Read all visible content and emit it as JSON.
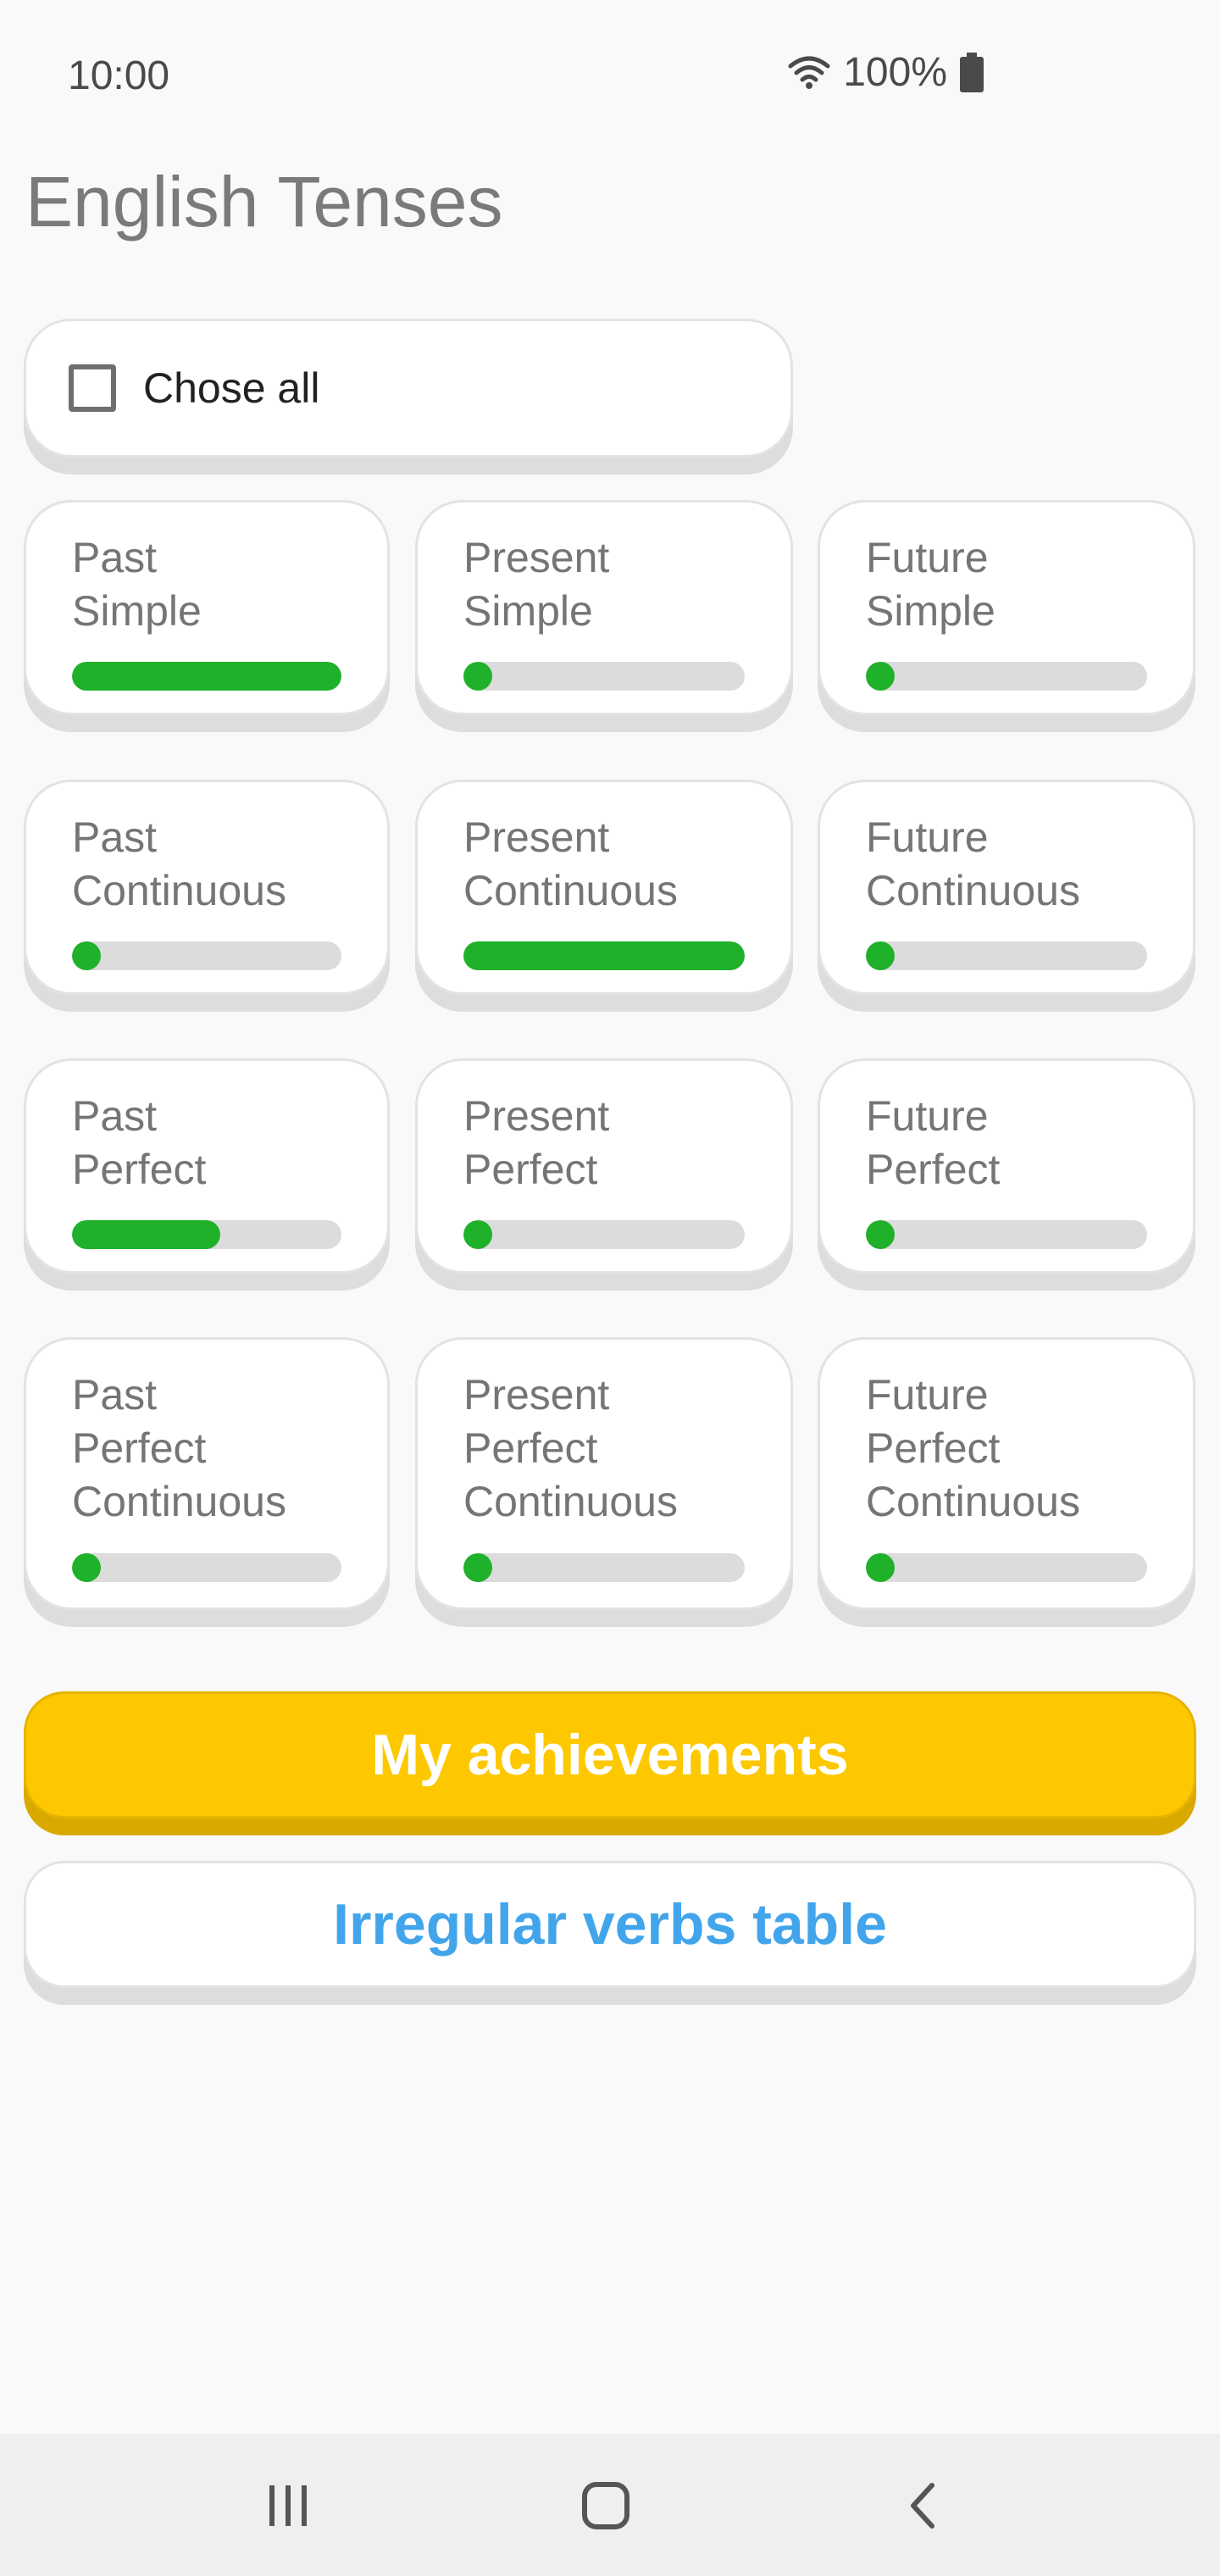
{
  "status_bar": {
    "time": "10:00",
    "battery": "100%",
    "icons": [
      "wifi-icon",
      "battery-icon"
    ]
  },
  "title": "English Tenses",
  "choose_all": {
    "label": "Chose all",
    "checked": false
  },
  "tenses": [
    {
      "line1": "Past",
      "line2": "Simple",
      "line3": "",
      "progress": 1.0
    },
    {
      "line1": "Present",
      "line2": "Simple",
      "line3": "",
      "progress": 0.0
    },
    {
      "line1": "Future",
      "line2": "Simple",
      "line3": "",
      "progress": 0.0
    },
    {
      "line1": "Past",
      "line2": "Continuous",
      "line3": "",
      "progress": 0.0
    },
    {
      "line1": "Present",
      "line2": "Continuous",
      "line3": "",
      "progress": 1.0
    },
    {
      "line1": "Future",
      "line2": "Continuous",
      "line3": "",
      "progress": 0.0
    },
    {
      "line1": "Past",
      "line2": "Perfect",
      "line3": "",
      "progress": 0.55
    },
    {
      "line1": "Present",
      "line2": "Perfect",
      "line3": "",
      "progress": 0.0
    },
    {
      "line1": "Future",
      "line2": "Perfect",
      "line3": "",
      "progress": 0.0
    },
    {
      "line1": "Past",
      "line2": "Perfect",
      "line3": "Continuous",
      "progress": 0.0
    },
    {
      "line1": "Present",
      "line2": "Perfect",
      "line3": "Continuous",
      "progress": 0.0
    },
    {
      "line1": "Future",
      "line2": "Perfect",
      "line3": "Continuous",
      "progress": 0.0
    }
  ],
  "buttons": {
    "achievements": "My achievements",
    "verbs_table": "Irregular verbs table"
  },
  "colors": {
    "progress_fill": "#1fb12a",
    "progress_track": "#dcdcdc",
    "achievements_bg": "#fdc800",
    "verbs_text": "#42a5ec"
  },
  "nav": {
    "icons": [
      "recent-apps-icon",
      "home-icon",
      "back-icon"
    ]
  }
}
